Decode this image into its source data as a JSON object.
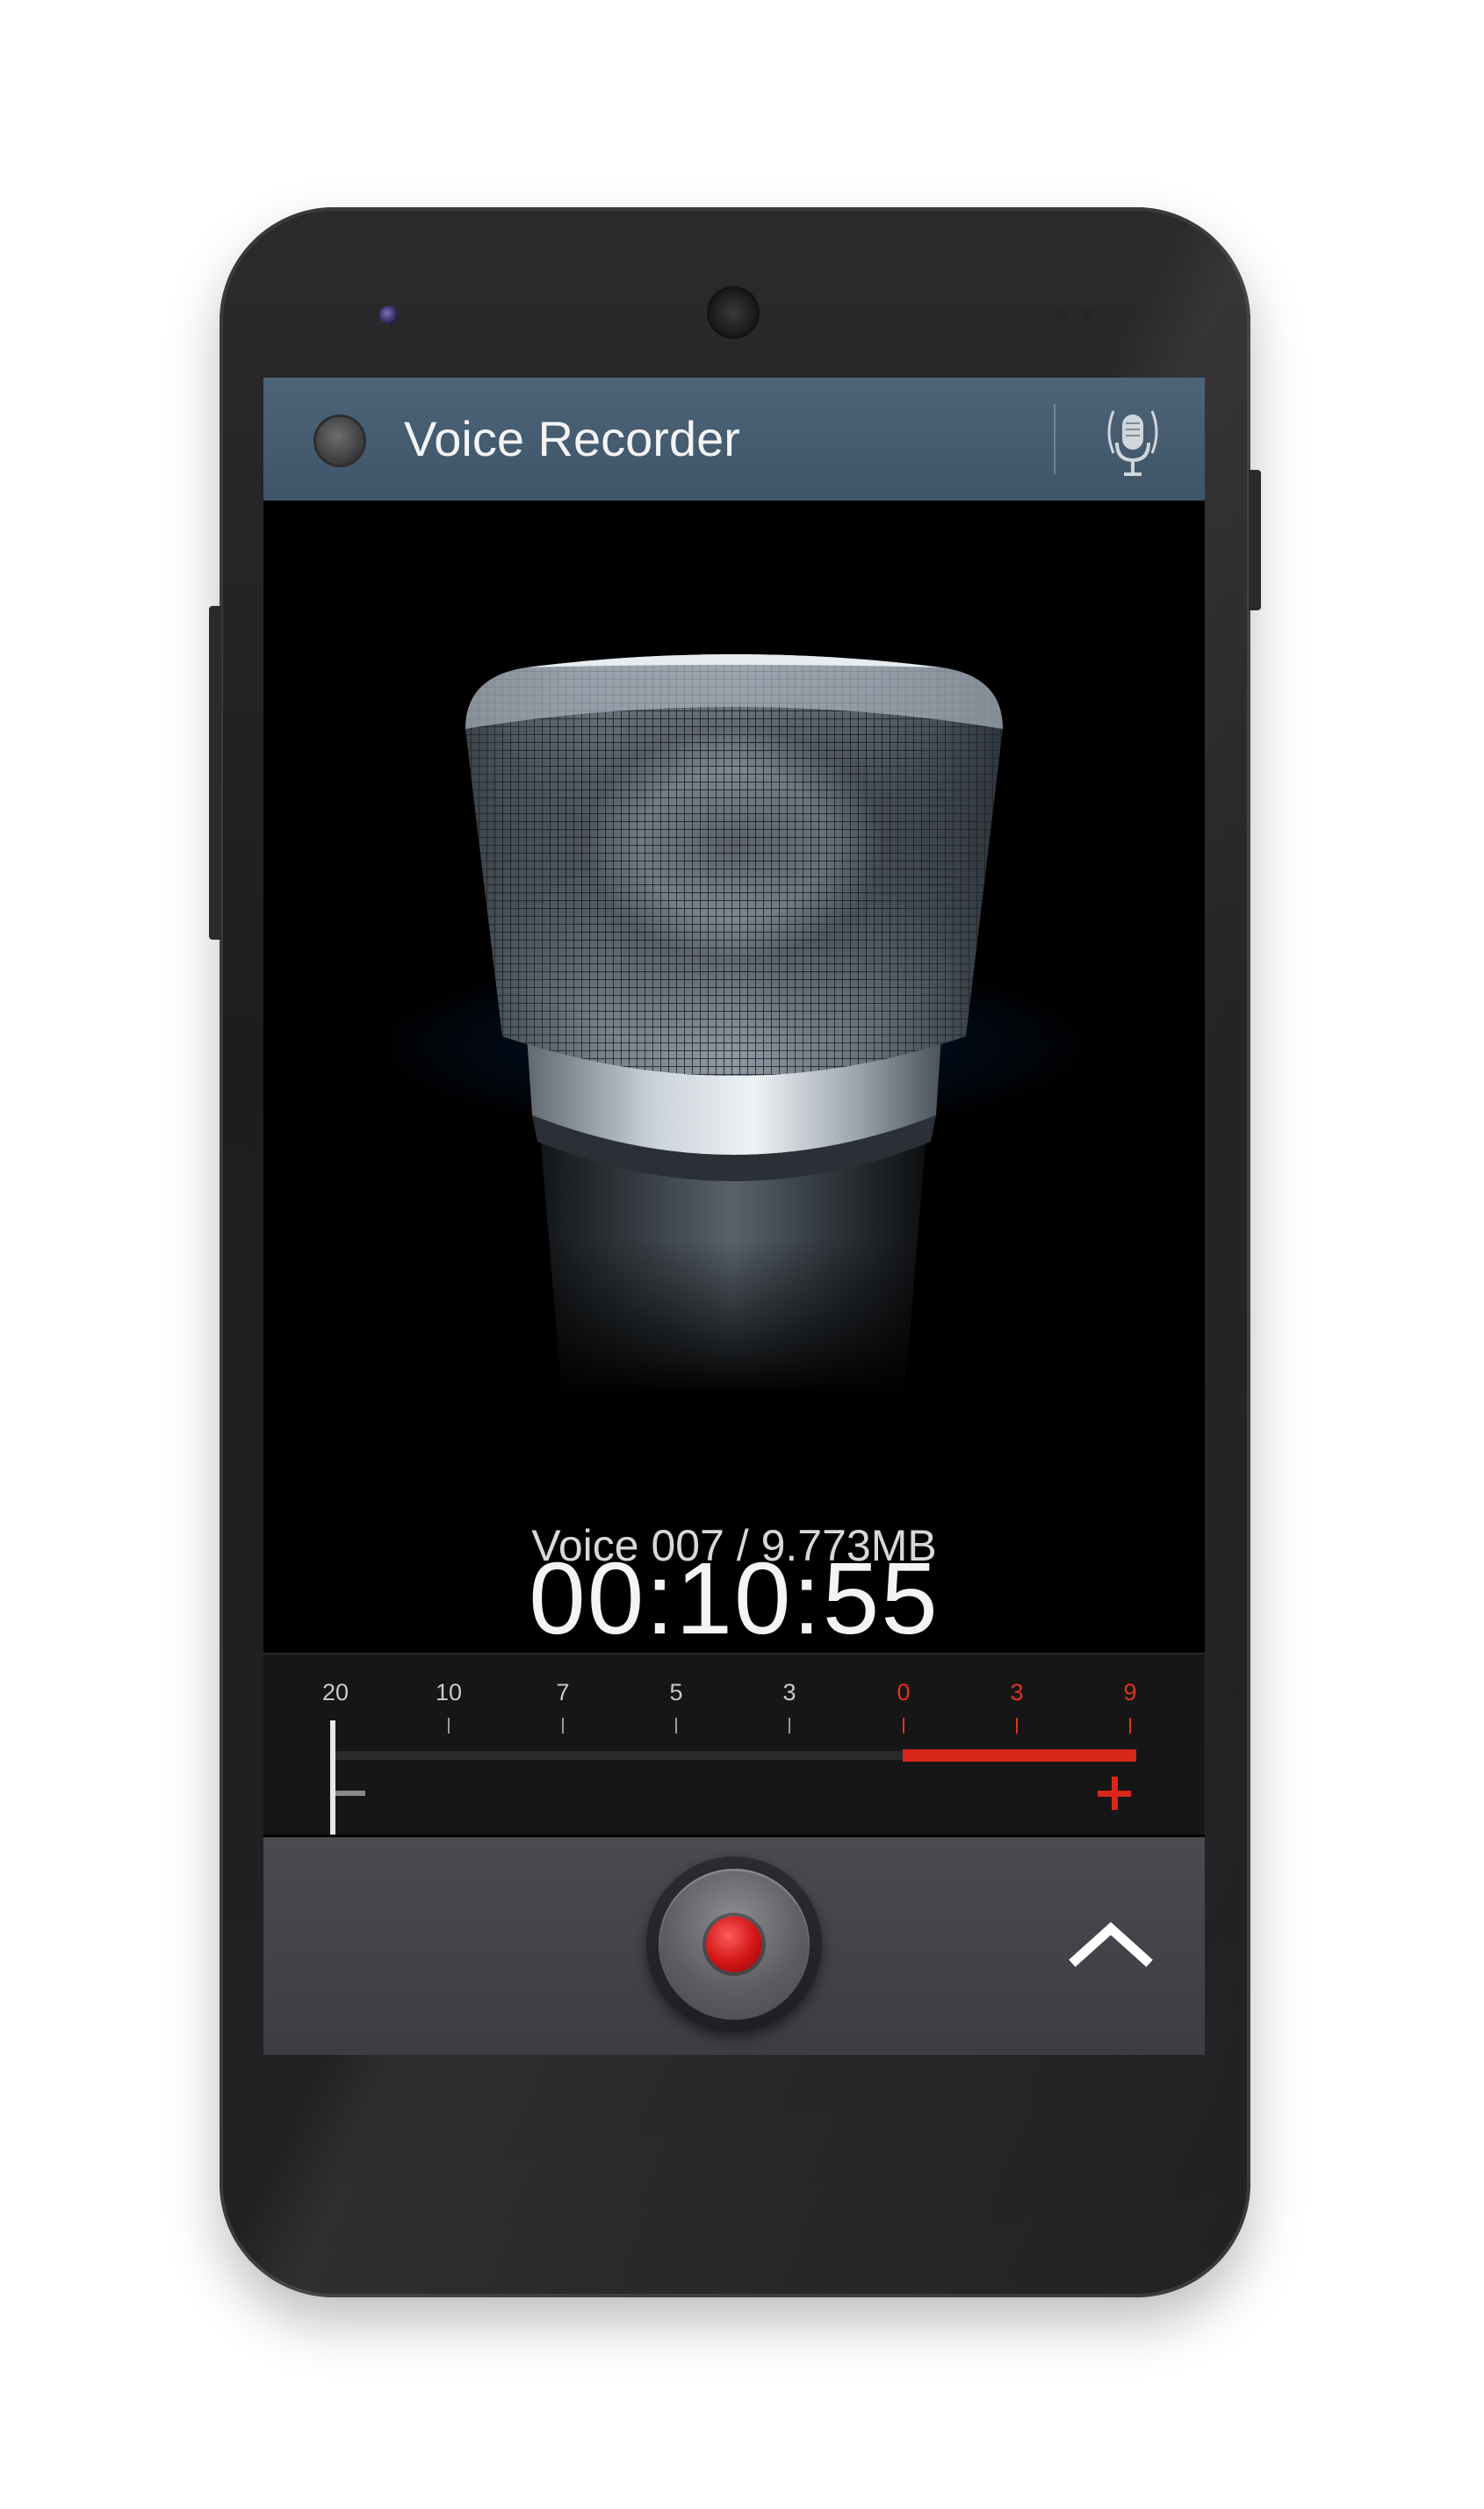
{
  "app": {
    "title": "Voice Recorder"
  },
  "icons": {
    "app_icon": "app-indicator-icon",
    "mode_icon": "microphone-icon",
    "record_icon": "record-icon",
    "expand_icon": "chevron-up-icon"
  },
  "recording": {
    "elapsed": "00:10:55",
    "file_info": "Voice 007 / 9.773MB"
  },
  "level_meter": {
    "scale": [
      {
        "label": "20",
        "hot": false
      },
      {
        "label": "10",
        "hot": false
      },
      {
        "label": "7",
        "hot": false
      },
      {
        "label": "5",
        "hot": false
      },
      {
        "label": "3",
        "hot": false
      },
      {
        "label": "0",
        "hot": true
      },
      {
        "label": "3",
        "hot": true
      },
      {
        "label": "9",
        "hot": true
      }
    ],
    "minus_symbol": "−",
    "plus_symbol": "+"
  },
  "colors": {
    "action_bar": "#4d6478",
    "accent_red": "#d9271b",
    "meter_bg": "#161617",
    "controls_bg": "#45464b"
  }
}
